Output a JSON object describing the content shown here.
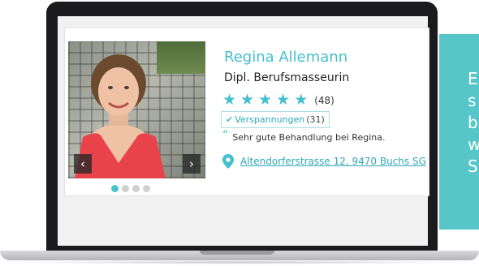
{
  "profile": {
    "name": "Regina Allemann",
    "title": "Dipl. Berufsmasseurin",
    "rating": {
      "stars": 5,
      "count": "(48)"
    },
    "tag": {
      "label": "Verspannungen",
      "count": "(31)"
    },
    "review_quote": "Sehr gute Behandlung bei Regina.",
    "address": "Altendorferstrasse 12, 9470 Buchs SG"
  },
  "carousel": {
    "prev_icon": "‹",
    "next_icon": "›",
    "dots": 4,
    "active_dot": 1
  },
  "side_panel": {
    "lines": [
      "E",
      "s",
      "b",
      "w",
      "S"
    ]
  },
  "colors": {
    "accent": "#45bfd0",
    "panel": "#57c6c8"
  }
}
